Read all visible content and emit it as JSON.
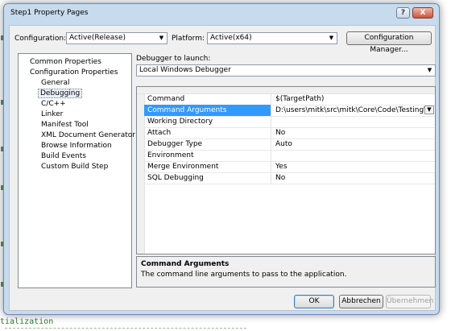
{
  "background": {
    "bottom_text": "tialization"
  },
  "dialog": {
    "title": "Step1 Property Pages",
    "help_label": "?",
    "close_label": "X"
  },
  "top": {
    "configuration_label": "Configuration:",
    "configuration_value": "Active(Release)",
    "platform_label": "Platform:",
    "platform_value": "Active(x64)",
    "config_manager_button": "Configuration Manager..."
  },
  "tree": {
    "items": [
      "Common Properties",
      "Configuration Properties",
      "General",
      "Debugging",
      "C/C++",
      "Linker",
      "Manifest Tool",
      "XML Document Generator",
      "Browse Information",
      "Build Events",
      "Custom Build Step"
    ],
    "selected": "Debugging"
  },
  "debugger": {
    "label": "Debugger to launch:",
    "value": "Local Windows Debugger"
  },
  "properties": [
    {
      "name": "Command",
      "value": "$(TargetPath)"
    },
    {
      "name": "Command Arguments",
      "value": "D:\\users\\mitk\\src\\mitk\\Core\\Code\\Testing\\Data\\Ori"
    },
    {
      "name": "Working Directory",
      "value": ""
    },
    {
      "name": "Attach",
      "value": "No"
    },
    {
      "name": "Debugger Type",
      "value": "Auto"
    },
    {
      "name": "Environment",
      "value": ""
    },
    {
      "name": "Merge Environment",
      "value": "Yes"
    },
    {
      "name": "SQL Debugging",
      "value": "No"
    }
  ],
  "description": {
    "title": "Command Arguments",
    "text": "The command line arguments to pass to the application."
  },
  "buttons": {
    "ok": "OK",
    "cancel": "Abbrechen",
    "apply": "Übernehmen"
  },
  "colors": {
    "selection": "#3399ff",
    "frame": "#c7dbee"
  }
}
